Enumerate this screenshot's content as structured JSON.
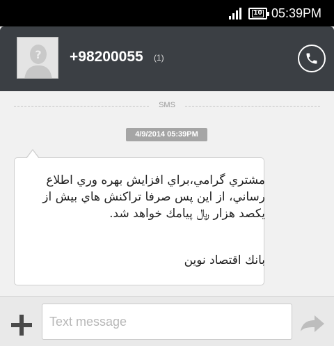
{
  "status_bar": {
    "battery_level": "10",
    "time": "05:39PM"
  },
  "contact": {
    "number": "+98200055",
    "thread_count": "(1)"
  },
  "divider": {
    "label": "SMS"
  },
  "message": {
    "timestamp": "4/9/2014 05:39PM",
    "body": "مشتري گرامي،براي افزايش بهره وري اطلاع رساني، از اين پس صرفا تراكنش هاي بيش از يكصد هزار ﷼ پيامك خواهد شد.",
    "sender_line": "بانك اقتصاد نوين"
  },
  "compose": {
    "placeholder": "Text message"
  },
  "icons": {
    "attach": "plus-icon",
    "send": "send-arrow-icon",
    "call": "phone-icon",
    "avatar": "default-avatar-icon"
  }
}
